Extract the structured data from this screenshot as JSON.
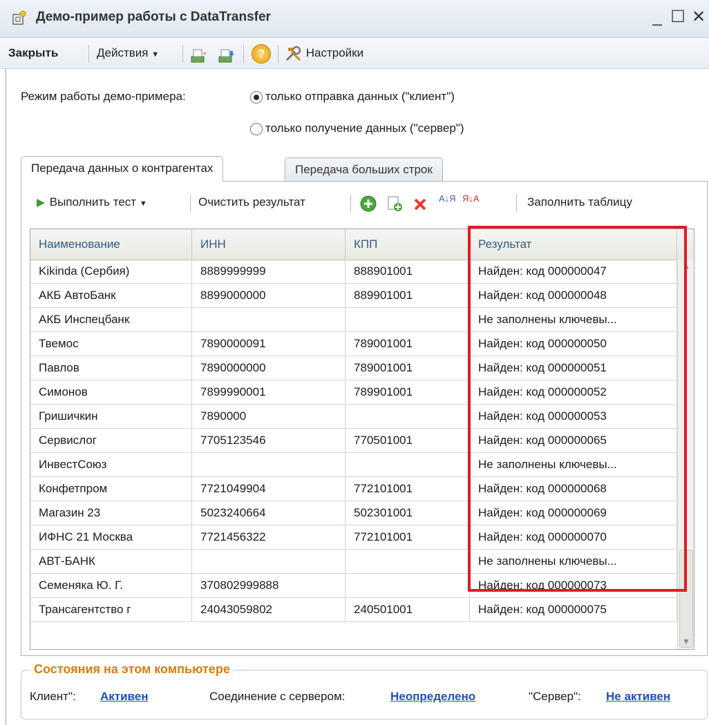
{
  "window": {
    "title": "Демо-пример работы с DataTransfer",
    "minimize_glyph": "_",
    "maximize_glyph": "☐",
    "close_glyph": "✕"
  },
  "toolbar": {
    "close_label": "Закрыть",
    "actions_label": "Действия",
    "settings_label": "Настройки",
    "help_glyph": "?"
  },
  "mode": {
    "label": "Режим работы демо-примера:",
    "options": [
      {
        "label": "только отправка данных (\"клиент\")",
        "selected": true
      },
      {
        "label": "только получение данных (\"сервер\")",
        "selected": false
      }
    ]
  },
  "tabs": [
    {
      "label": "Передача данных о контрагентах",
      "active": true
    },
    {
      "label": "Передача больших строк",
      "active": false
    }
  ],
  "panel_toolbar": {
    "run_test_label": "Выполнить тест",
    "clear_result_label": "Очистить результат",
    "fill_table_label": "Заполнить таблицу",
    "sort_asc_glyph": "А↓Я",
    "sort_desc_glyph": "Я↓А"
  },
  "table": {
    "columns": [
      "Наименование",
      "ИНН",
      "КПП",
      "Результат"
    ],
    "rows": [
      [
        "Kikinda (Сербия)",
        "8889999999",
        "888901001",
        "Найден: код 000000047"
      ],
      [
        "АКБ АвтоБанк",
        "8899000000",
        "889901001",
        "Найден: код 000000048"
      ],
      [
        "АКБ Инспецбанк",
        "",
        "",
        "Не заполнены ключевы..."
      ],
      [
        "Твемос",
        "7890000091",
        "789001001",
        "Найден: код 000000050"
      ],
      [
        "Павлов",
        "7890000000",
        "789001001",
        "Найден: код 000000051"
      ],
      [
        "Симонов",
        "7899990001",
        "789901001",
        "Найден: код 000000052"
      ],
      [
        "Гришичкин",
        "7890000",
        "",
        "Найден: код 000000053"
      ],
      [
        "Сервислог",
        "7705123546",
        "770501001",
        "Найден: код 000000065"
      ],
      [
        "ИнвестСоюз",
        "",
        "",
        "Не заполнены ключевы..."
      ],
      [
        "Конфетпром",
        "7721049904",
        "772101001",
        "Найден: код 000000068"
      ],
      [
        "Магазин 23",
        "5023240664",
        "502301001",
        "Найден: код 000000069"
      ],
      [
        "ИФНС 21 Москва",
        "7721456322",
        "772101001",
        "Найден: код 000000070"
      ],
      [
        "АВТ-БАНК",
        "",
        "",
        "Не заполнены ключевы..."
      ],
      [
        "Семеняка Ю. Г.",
        "370802999888",
        "",
        "Найден: код 000000073"
      ],
      [
        "Трансагентство г",
        "24043059802",
        "240501001",
        "Найден: код 000000075"
      ]
    ]
  },
  "status": {
    "group_title": "Состояния на этом компьютере",
    "client_label": "Клиент\":",
    "client_value": "Активен",
    "connection_label": "Соединение с сервером:",
    "connection_value": "Неопределено",
    "server_label": "\"Сервер\":",
    "server_value": "Не активен"
  },
  "colors": {
    "highlight": "#e01b24",
    "group_title": "#d67d12",
    "link": "#1f4fb5",
    "header_text": "#355a82"
  }
}
